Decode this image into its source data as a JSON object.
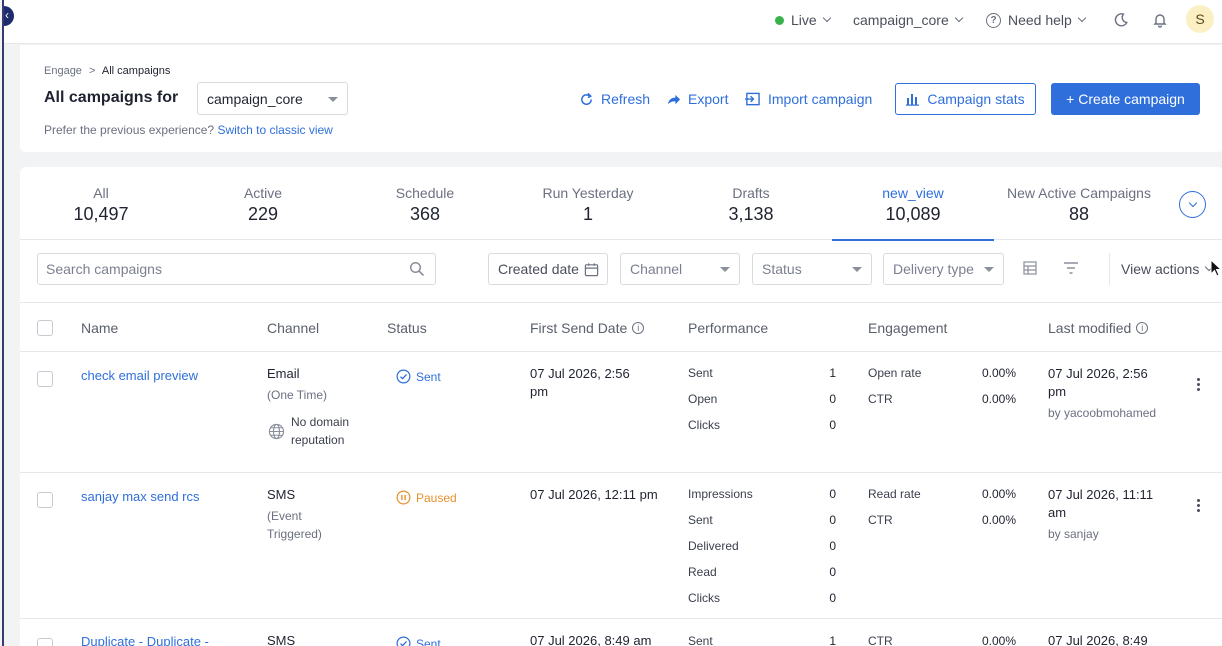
{
  "topbar": {
    "env": "Live",
    "workspace": "campaign_core",
    "help": "Need help",
    "avatar_initial": "S"
  },
  "header": {
    "breadcrumb_parent": "Engage",
    "breadcrumb_sep": ">",
    "breadcrumb_current": "All campaigns",
    "title": "All campaigns for",
    "workspace_select": "campaign_core",
    "subline_text": "Prefer the previous experience?",
    "subline_link": "Switch to classic view",
    "refresh": "Refresh",
    "export": "Export",
    "import": "Import campaign",
    "stats": "Campaign stats",
    "create": "+ Create campaign"
  },
  "tabs": [
    {
      "label": "All",
      "count": "10,497"
    },
    {
      "label": "Active",
      "count": "229"
    },
    {
      "label": "Schedule",
      "count": "368"
    },
    {
      "label": "Run Yesterday",
      "count": "1"
    },
    {
      "label": "Drafts",
      "count": "3,138"
    },
    {
      "label": "new_view",
      "count": "10,089"
    },
    {
      "label": "New Active Campaigns",
      "count": "88"
    }
  ],
  "filters": {
    "search_placeholder": "Search campaigns",
    "created_date": "Created date",
    "channel": "Channel",
    "status": "Status",
    "delivery_type": "Delivery type",
    "view_actions": "View actions"
  },
  "columns": {
    "name": "Name",
    "channel": "Channel",
    "status": "Status",
    "first_send": "First Send Date",
    "performance": "Performance",
    "engagement": "Engagement",
    "last_modified": "Last modified"
  },
  "rows": [
    {
      "name": "check email preview",
      "channel": "Email",
      "channel_sub": "(One Time)",
      "domain_line1": "No domain",
      "domain_line2": "reputation",
      "status": "Sent",
      "first_send_l1": "07 Jul 2026, 2:56",
      "first_send_l2": "pm",
      "perf": [
        {
          "label": "Sent",
          "value": "1"
        },
        {
          "label": "Open",
          "value": "0"
        },
        {
          "label": "Clicks",
          "value": "0"
        }
      ],
      "eng": [
        {
          "label": "Open rate",
          "value": "0.00%"
        },
        {
          "label": "CTR",
          "value": "0.00%"
        }
      ],
      "modified_l1": "07 Jul 2026, 2:56",
      "modified_l2": "pm",
      "modified_by": "by yacoobmohamed"
    },
    {
      "name": "sanjay max send rcs",
      "channel": "SMS",
      "channel_sub_l1": "(Event",
      "channel_sub_l2": "Triggered)",
      "status": "Paused",
      "first_send_l1": "07 Jul 2026, 12:11 pm",
      "perf": [
        {
          "label": "Impressions",
          "value": "0"
        },
        {
          "label": "Sent",
          "value": "0"
        },
        {
          "label": "Delivered",
          "value": "0"
        },
        {
          "label": "Read",
          "value": "0"
        },
        {
          "label": "Clicks",
          "value": "0"
        }
      ],
      "eng": [
        {
          "label": "Read rate",
          "value": "0.00%"
        },
        {
          "label": "CTR",
          "value": "0.00%"
        }
      ],
      "modified_l1": "07 Jul 2026, 11:11",
      "modified_l2": "am",
      "modified_by": "by sanjay"
    },
    {
      "name": "Duplicate - Duplicate -",
      "channel": "SMS",
      "status": "Sent",
      "first_send_l1": "07 Jul 2026, 8:49 am",
      "perf": [
        {
          "label": "Sent",
          "value": "1"
        }
      ],
      "eng": [
        {
          "label": "CTR",
          "value": "0.00%"
        }
      ],
      "modified_l1": "07 Jul 2026, 8:49"
    }
  ],
  "colors": {
    "accent": "#2f6fdc",
    "live": "#37b24d",
    "paused": "#e8912d"
  }
}
